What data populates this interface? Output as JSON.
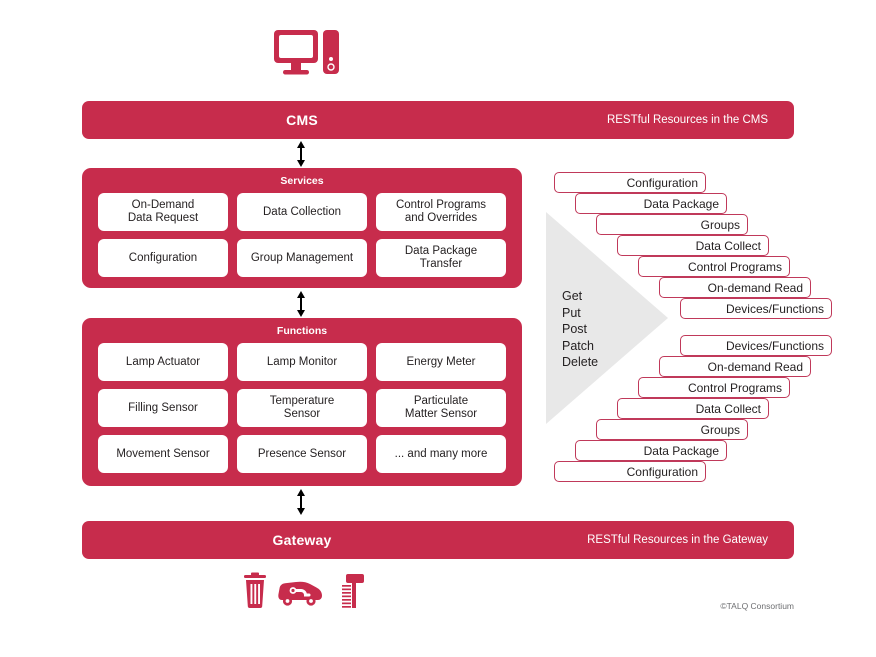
{
  "colors": {
    "brand_red": "#c72c4c",
    "step_border": "#c0395a",
    "gray_arrow": "#e8e8e8",
    "text_dark": "#231f20",
    "white": "#ffffff"
  },
  "top_icon": "desktop-computer-icon",
  "cms_bar": {
    "title": "CMS",
    "subtitle": "RESTful Resources in the CMS"
  },
  "gateway_bar": {
    "title": "Gateway",
    "subtitle": "RESTful Resources in the Gateway"
  },
  "services_panel": {
    "title": "Services",
    "cells": [
      "On-Demand\nData Request",
      "Data Collection",
      "Control Programs\nand Overrides",
      "Configuration",
      "Group Management",
      "Data Package\nTransfer"
    ]
  },
  "functions_panel": {
    "title": "Functions",
    "cells": [
      "Lamp Actuator",
      "Lamp Monitor",
      "Energy Meter",
      "Filling Sensor",
      "Temperature\nSensor",
      "Particulate\nMatter Sensor",
      "Movement Sensor",
      "Presence Sensor",
      "... and many more"
    ]
  },
  "http_verbs": [
    "Get",
    "Put",
    "Post",
    "Patch",
    "Delete"
  ],
  "staircase_top": [
    "Configuration",
    "Data Package",
    "Groups",
    "Data Collect",
    "Control Programs",
    "On-demand Read",
    "Devices/Functions"
  ],
  "staircase_bottom": [
    "Devices/Functions",
    "On-demand Read",
    "Control Programs",
    "Data Collect",
    "Groups",
    "Data Package",
    "Configuration"
  ],
  "bottom_icons": [
    "waste-bin-icon",
    "electric-car-icon",
    "street-lamp-icon"
  ],
  "copyright": "©TALQ Consortium",
  "arrows": [
    "cms-to-services-arrow",
    "services-to-functions-arrow",
    "functions-to-gateway-arrow"
  ]
}
